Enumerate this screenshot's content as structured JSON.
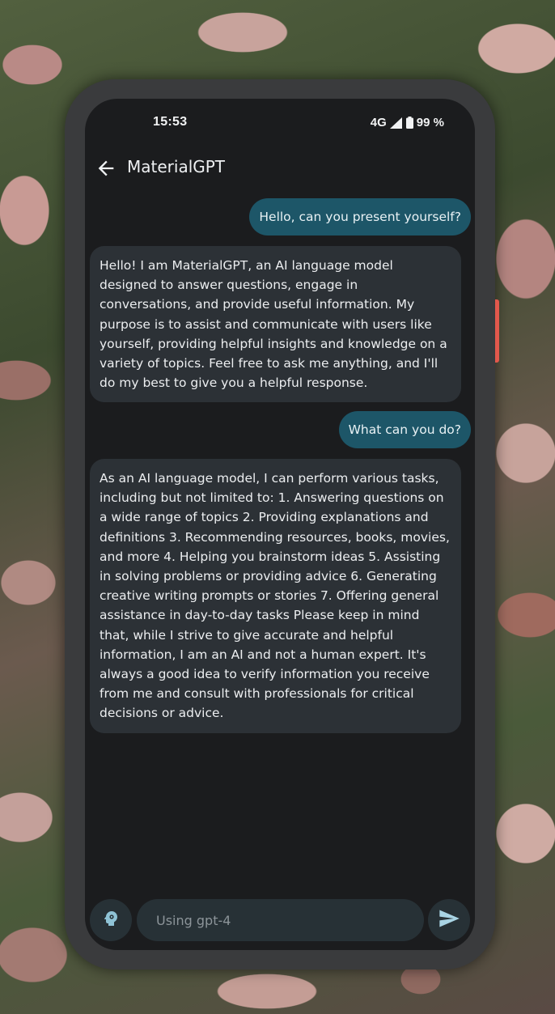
{
  "status_bar": {
    "time": "15:53",
    "network": "4G",
    "battery": "99 %"
  },
  "app_bar": {
    "back_icon": "arrow-left-icon",
    "title": "MaterialGPT"
  },
  "messages": [
    {
      "role": "user",
      "text": "Hello, can you present yourself?"
    },
    {
      "role": "assistant",
      "text": "Hello! I am MaterialGPT, an AI language model designed to answer questions, engage in conversations, and provide useful information. My purpose is to assist and communicate with users like yourself, providing helpful insights and knowledge on a variety of topics. Feel free to ask me anything, and I'll do my best to give you a helpful response."
    },
    {
      "role": "user",
      "text": "What can you do?"
    },
    {
      "role": "assistant",
      "text": "As an AI language model, I can perform various tasks, including but not limited to: 1. Answering questions on a wide range of topics 2. Providing explanations and definitions 3. Recommending resources, books, movies, and more 4. Helping you brainstorm ideas 5. Assisting in solving problems or providing advice 6. Generating creative writing prompts or stories 7. Offering general assistance in day-to-day tasks Please keep in mind that, while I strive to give accurate and helpful information, I am an AI and not a human expert. It's always a good idea to verify information you receive from me and consult with professionals for critical decisions or advice."
    }
  ],
  "input_bar": {
    "persona_icon": "head-gear-icon",
    "placeholder": "Using gpt-4",
    "value": "",
    "send_icon": "send-icon"
  },
  "colors": {
    "screen_background": "#1b1c1e",
    "user_bubble": "#1d5668",
    "assistant_bubble": "#2c3136",
    "input_background": "#273136",
    "accent": "#8fc3d6"
  }
}
